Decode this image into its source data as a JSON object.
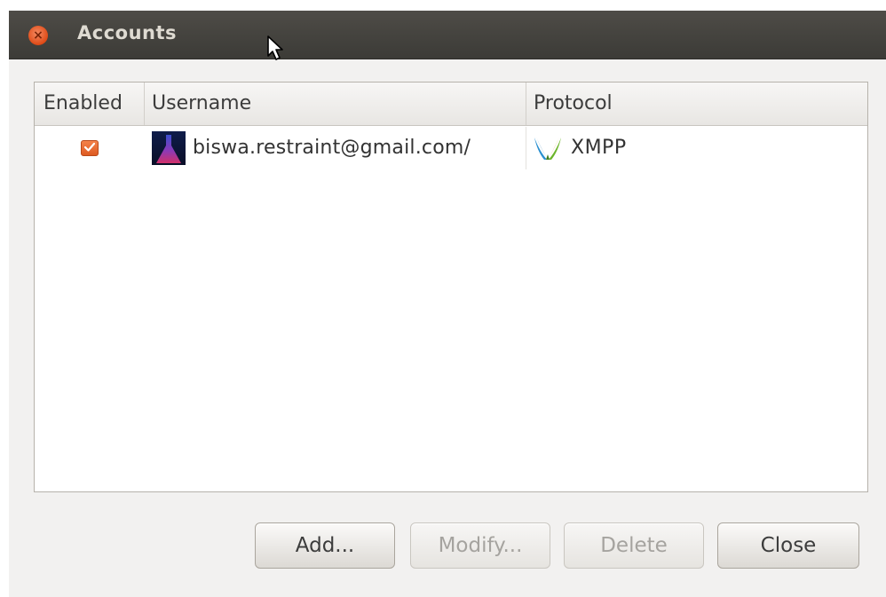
{
  "window": {
    "title": "Accounts"
  },
  "table": {
    "columns": [
      "Enabled",
      "Username",
      "Protocol"
    ],
    "rows": [
      {
        "enabled": true,
        "username": "biswa.restraint@gmail.com/",
        "protocol": "XMPP"
      }
    ]
  },
  "buttons": {
    "add": "Add...",
    "modify": "Modify...",
    "delete": "Delete",
    "close": "Close"
  },
  "colors": {
    "titlebar": "#3c3b37",
    "accent": "#df4a16",
    "background": "#f2f1f0"
  }
}
